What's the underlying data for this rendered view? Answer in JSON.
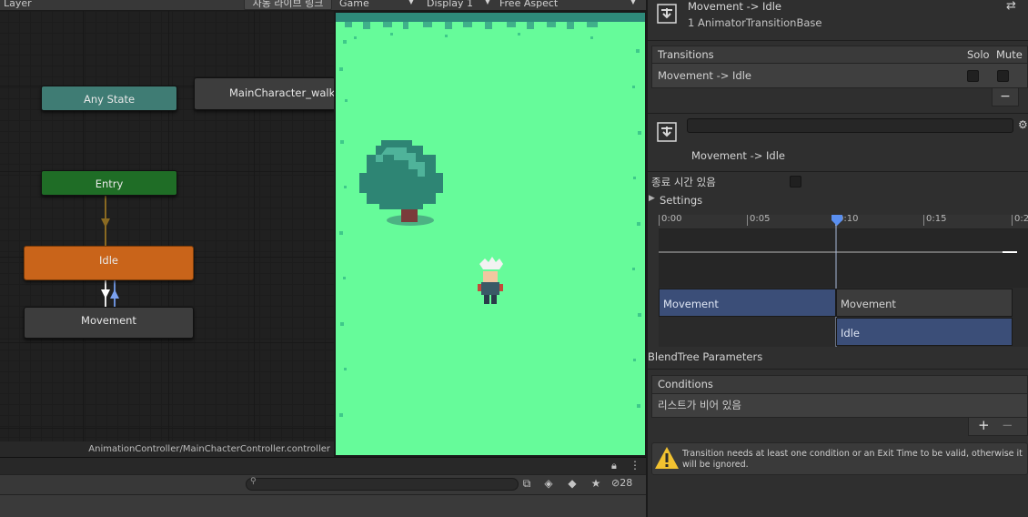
{
  "animator": {
    "layer_label": "Layer",
    "live_link_label": "자동 라이브 링크",
    "states": {
      "any_state": "Any State",
      "walk": "MainCharacter_walk",
      "entry": "Entry",
      "idle": "Idle",
      "movement": "Movement"
    },
    "footer_path": "AnimationController/MainChacterController.controller",
    "colors": {
      "any_state": "#3f7c74",
      "entry": "#1f6d26",
      "idle": "#c9641a",
      "default": "#3d3d3d"
    }
  },
  "game": {
    "tab_label": "Game",
    "display_label": "Display 1",
    "aspect_label": "Free Aspect",
    "grass_color": "#66fb9a"
  },
  "project": {
    "search_placeholder": "",
    "hidden_count": "28"
  },
  "inspector": {
    "title": "Movement -> Idle",
    "subtitle": "1 AnimatorTransitionBase",
    "transitions_header": "Transitions",
    "solo_label": "Solo",
    "mute_label": "Mute",
    "transition_item": "Movement -> Idle",
    "transition_name_value": "",
    "transition_label": "Movement -> Idle",
    "has_exit_time_label": "종료 시간 있음",
    "settings_label": "Settings",
    "timeline": {
      "ticks": [
        "0:00",
        "0:05",
        "0:10",
        "0:15",
        "0:2"
      ],
      "clips": {
        "source": "Movement",
        "source_continue": "Movement",
        "destination": "Idle"
      }
    },
    "blendtree_label": "BlendTree Parameters",
    "conditions_header": "Conditions",
    "conditions_empty": "리스트가 비어 있음",
    "add_label": "+",
    "remove_label": "−",
    "warning_text": "Transition needs at least one condition or an Exit Time to be valid, otherwise it will be ignored."
  }
}
